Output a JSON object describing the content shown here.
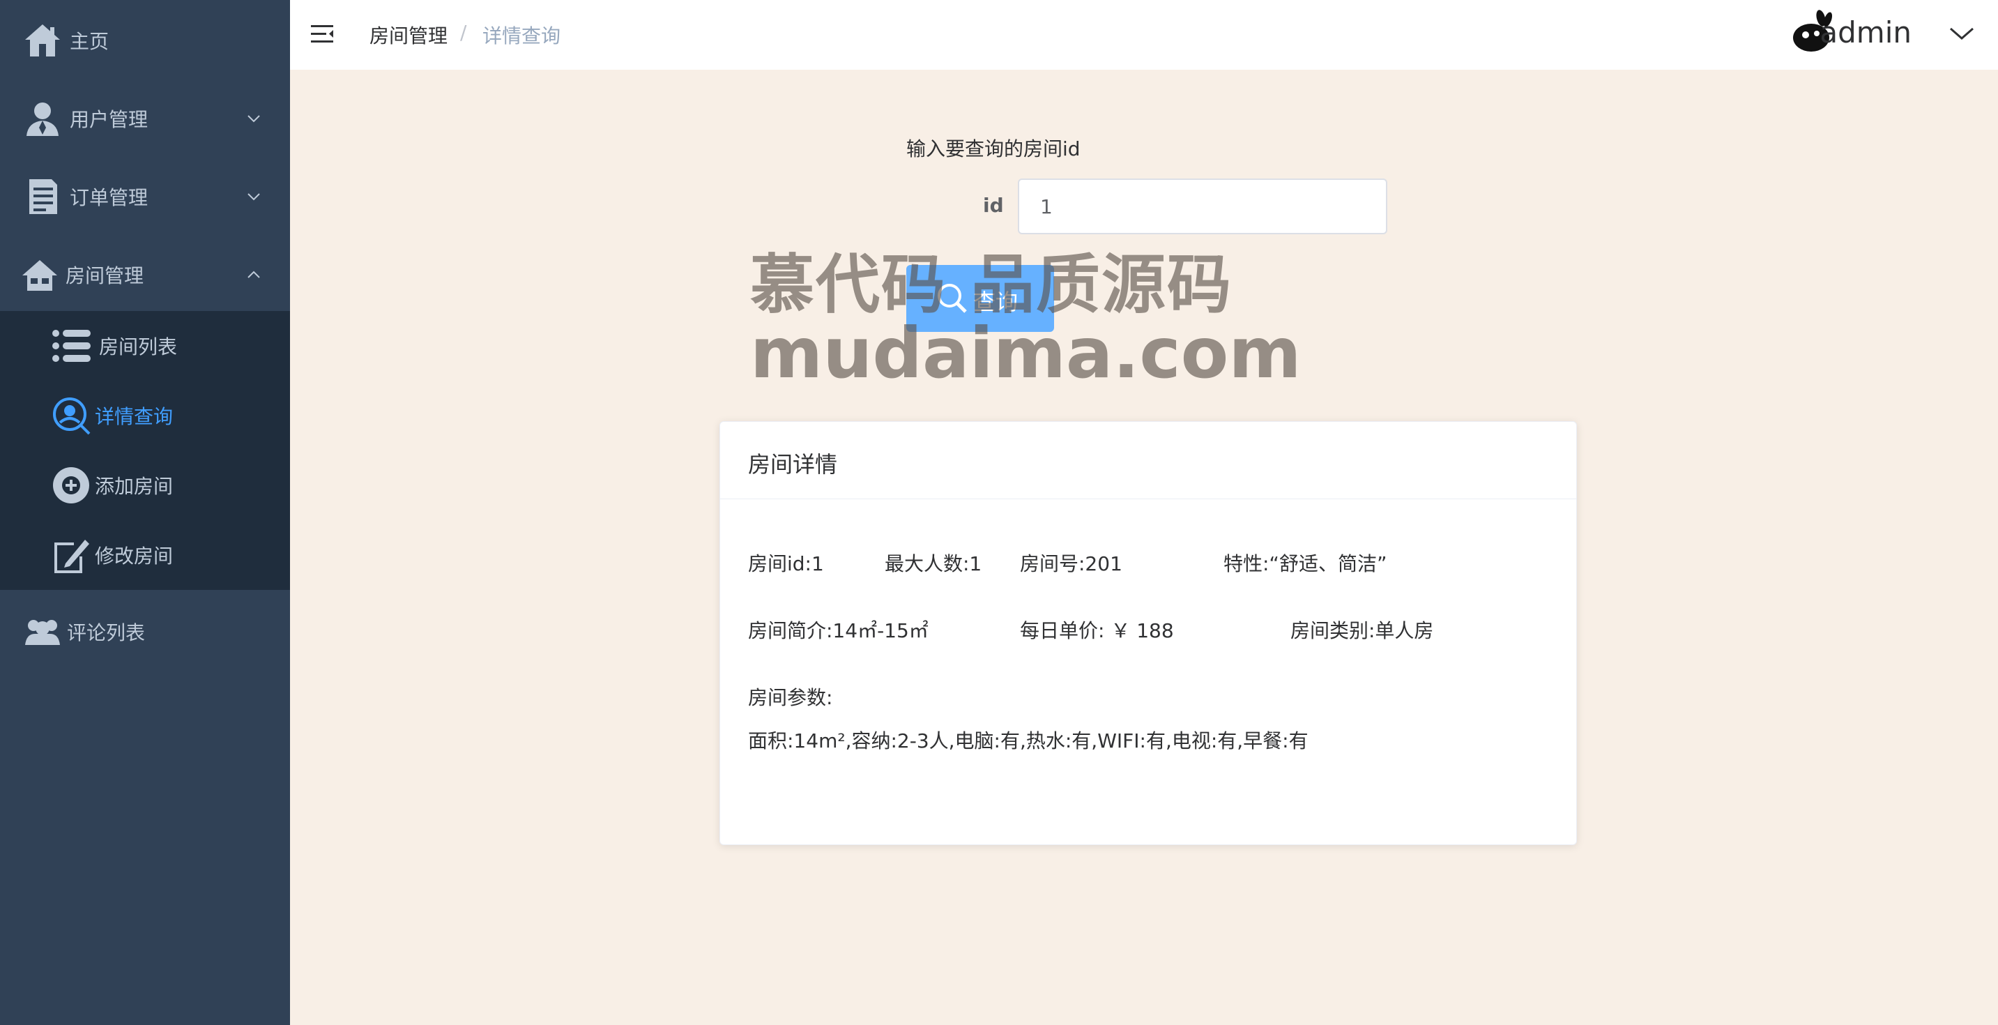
{
  "sidebar": {
    "home": "主页",
    "user_mgmt": "用户管理",
    "order_mgmt": "订单管理",
    "room_mgmt": "房间管理",
    "room_list": "房间列表",
    "detail_query": "详情查询",
    "add_room": "添加房间",
    "edit_room": "修改房间",
    "comment_list": "评论列表"
  },
  "header": {
    "breadcrumb": [
      "房间管理",
      "/",
      "详情查询"
    ],
    "username": "admin"
  },
  "form": {
    "hint": "输入要查询的房间id",
    "id_label": "id",
    "id_value": "1",
    "query_button": "查询"
  },
  "watermark": {
    "line1": "慕代码 品质源码",
    "line2": "mudaima.com"
  },
  "card": {
    "title": "房间详情",
    "room_id": "房间id:1",
    "max_people": "最大人数:1",
    "room_number": "房间号:201",
    "feature": "特性:“舒适、简洁”",
    "intro": "房间简介:14㎡-15㎡",
    "price": "每日单价: ￥ 188",
    "type": "房间类别:单人房",
    "params_label": "房间参数:",
    "params": "面积:14m²,容纳:2-3人,电脑:有,热水:有,WIFI:有,电视:有,早餐:有"
  },
  "colors": {
    "sidebar_bg": "#304156",
    "submenu_bg": "#1f2d3d",
    "active": "#409eff",
    "button": "#66b1ff",
    "page_bg": "#f8efe6"
  }
}
